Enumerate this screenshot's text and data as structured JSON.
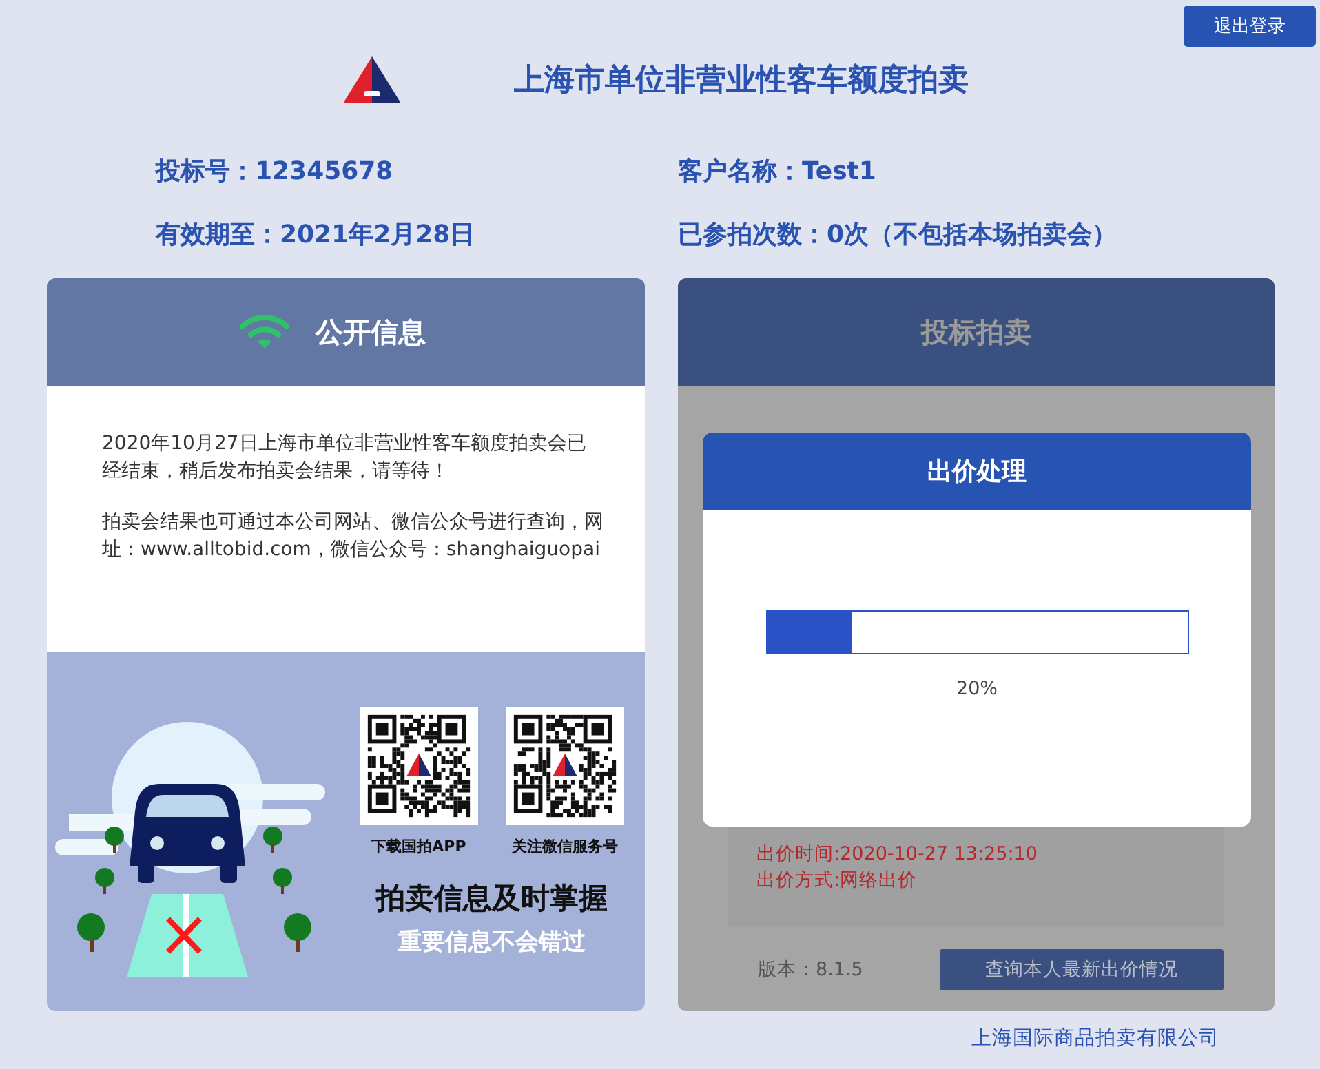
{
  "header": {
    "logout_button": "退出登录",
    "title": "上海市单位非营业性客车额度拍卖"
  },
  "info": [
    "投标号：12345678",
    "客户名称：Test1",
    "有效期至：2021年2月28日",
    "已参拍次数：0次（不包括本场拍卖会）"
  ],
  "public_panel": {
    "title": "公开信息",
    "paragraphs": [
      "2020年10月27日上海市单位非营业性客车额度拍卖会已经结束，稍后发布拍卖会结果，请等待！",
      "拍卖会结果也可通过本公司网站、微信公众号进行查询，网址：www.alltobid.com，微信公众号：shanghaiguopai"
    ],
    "qr_codes": [
      {
        "caption": "下载国拍APP"
      },
      {
        "caption": "关注微信服务号"
      }
    ],
    "slogan": "拍卖信息及时掌握",
    "subslogan": "重要信息不会错过"
  },
  "bid_panel": {
    "title": "投标拍卖",
    "bid_details": [
      "出价时间:2020-10-27 13:25:10",
      "出价方式:网络出价"
    ],
    "version": "版本：8.1.5",
    "query_button": "查询本人最新出价情况"
  },
  "dialog": {
    "title": "出价处理",
    "progress": {
      "level": 0.2
    },
    "reading": "20%"
  },
  "footer": "上海国际商品拍卖有限公司"
}
